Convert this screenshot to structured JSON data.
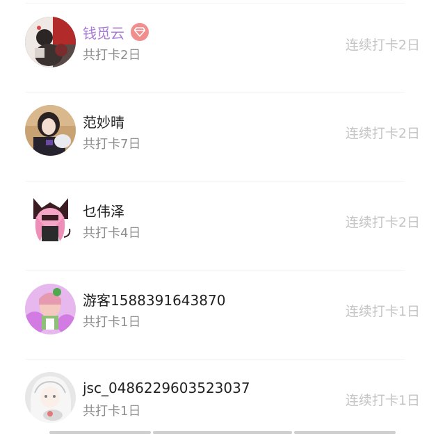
{
  "checkin_list": {
    "items": [
      {
        "name": "钱觅云",
        "vip": true,
        "total": "共打卡2日",
        "streak": "连续打卡2日",
        "avatar": "avatar-1"
      },
      {
        "name": "范妙晴",
        "vip": false,
        "total": "共打卡7日",
        "streak": "连续打卡2日",
        "avatar": "avatar-2"
      },
      {
        "name": "乜伟泽",
        "vip": false,
        "total": "共打卡4日",
        "streak": "连续打卡2日",
        "avatar": "avatar-3"
      },
      {
        "name": "游客1588391643870",
        "vip": false,
        "total": "共打卡1日",
        "streak": "连续打卡1日",
        "avatar": "avatar-4"
      },
      {
        "name": "jsc_0486229603523037",
        "vip": false,
        "total": "共打卡1日",
        "streak": "连续打卡1日",
        "avatar": "avatar-5"
      }
    ]
  },
  "colors": {
    "vip_name": "#a97ad9",
    "vip_badge": "#f18d8d",
    "name": "#222222",
    "secondary": "#8e8e8e",
    "streak": "#c4c4c4"
  }
}
